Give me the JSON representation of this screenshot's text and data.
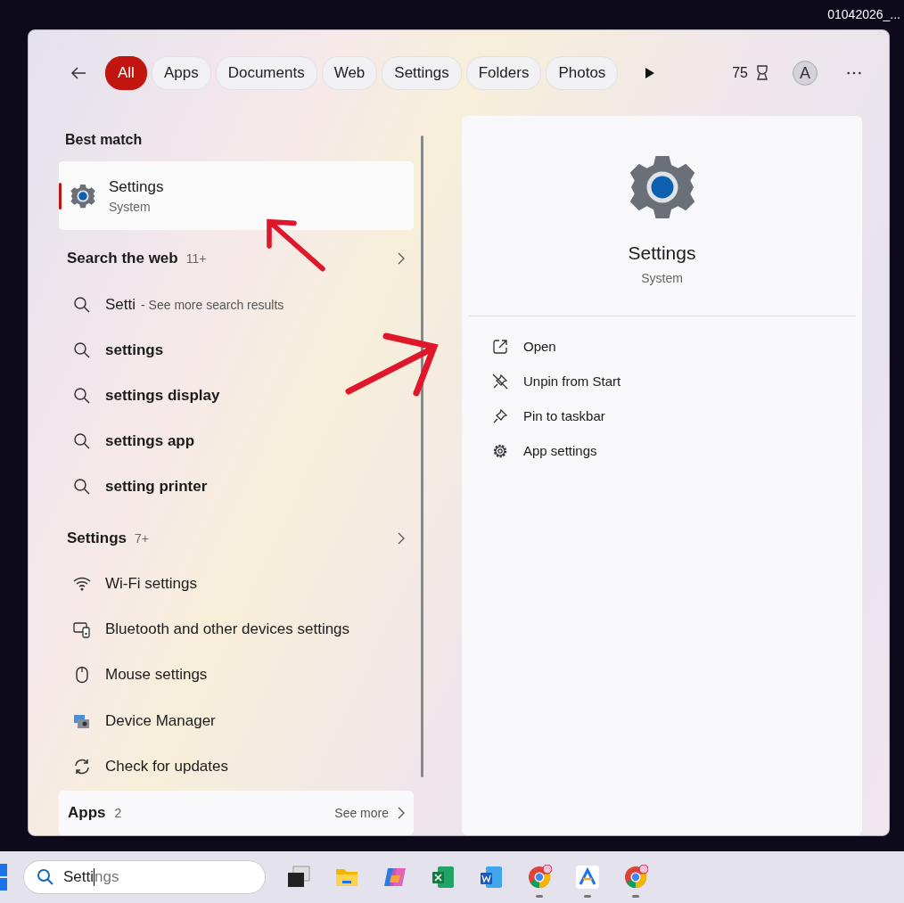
{
  "desktop_label": "01042026_...",
  "header": {
    "tabs": [
      {
        "label": "All",
        "selected": true
      },
      {
        "label": "Apps",
        "selected": false
      },
      {
        "label": "Documents",
        "selected": false
      },
      {
        "label": "Web",
        "selected": false
      },
      {
        "label": "Settings",
        "selected": false
      },
      {
        "label": "Folders",
        "selected": false
      },
      {
        "label": "Photos",
        "selected": false
      }
    ],
    "points": "75",
    "avatar": "A"
  },
  "best_match": {
    "heading": "Best match",
    "item": {
      "title": "Settings",
      "subtitle": "System",
      "selected": true
    }
  },
  "sections": [
    {
      "heading": "Search the web",
      "count": "11+",
      "items": [
        {
          "kind": "web",
          "title": "Setti",
          "hint": "- See more search results"
        },
        {
          "kind": "web",
          "title": "settings"
        },
        {
          "kind": "web",
          "title": "settings display"
        },
        {
          "kind": "web",
          "title": "settings app"
        },
        {
          "kind": "web",
          "title": "setting printer"
        }
      ]
    },
    {
      "heading": "Settings",
      "count": "7+",
      "items": [
        {
          "kind": "wifi",
          "title": "Wi-Fi settings"
        },
        {
          "kind": "bluetooth",
          "title": "Bluetooth and other devices settings"
        },
        {
          "kind": "mouse",
          "title": "Mouse settings"
        },
        {
          "kind": "device-manager",
          "title": "Device Manager"
        },
        {
          "kind": "update",
          "title": "Check for updates"
        }
      ]
    }
  ],
  "apps_bar": {
    "heading": "Apps",
    "count": "2",
    "link": "See more"
  },
  "detail": {
    "title": "Settings",
    "subtitle": "System",
    "actions": [
      {
        "kind": "open",
        "label": "Open"
      },
      {
        "kind": "unpin",
        "label": "Unpin from Start"
      },
      {
        "kind": "pin",
        "label": "Pin to taskbar"
      },
      {
        "kind": "gear",
        "label": "App settings"
      }
    ]
  },
  "taskbar": {
    "search": {
      "value": "Setti",
      "suggestion": "ngs"
    },
    "apps": [
      {
        "kind": "task-view",
        "running": false
      },
      {
        "kind": "folder",
        "running": false
      },
      {
        "kind": "copilot",
        "running": false
      },
      {
        "kind": "excel",
        "running": false
      },
      {
        "kind": "word",
        "running": false
      },
      {
        "kind": "chrome",
        "running": true
      },
      {
        "kind": "a-app",
        "running": true
      },
      {
        "kind": "chrome",
        "running": true
      }
    ]
  }
}
